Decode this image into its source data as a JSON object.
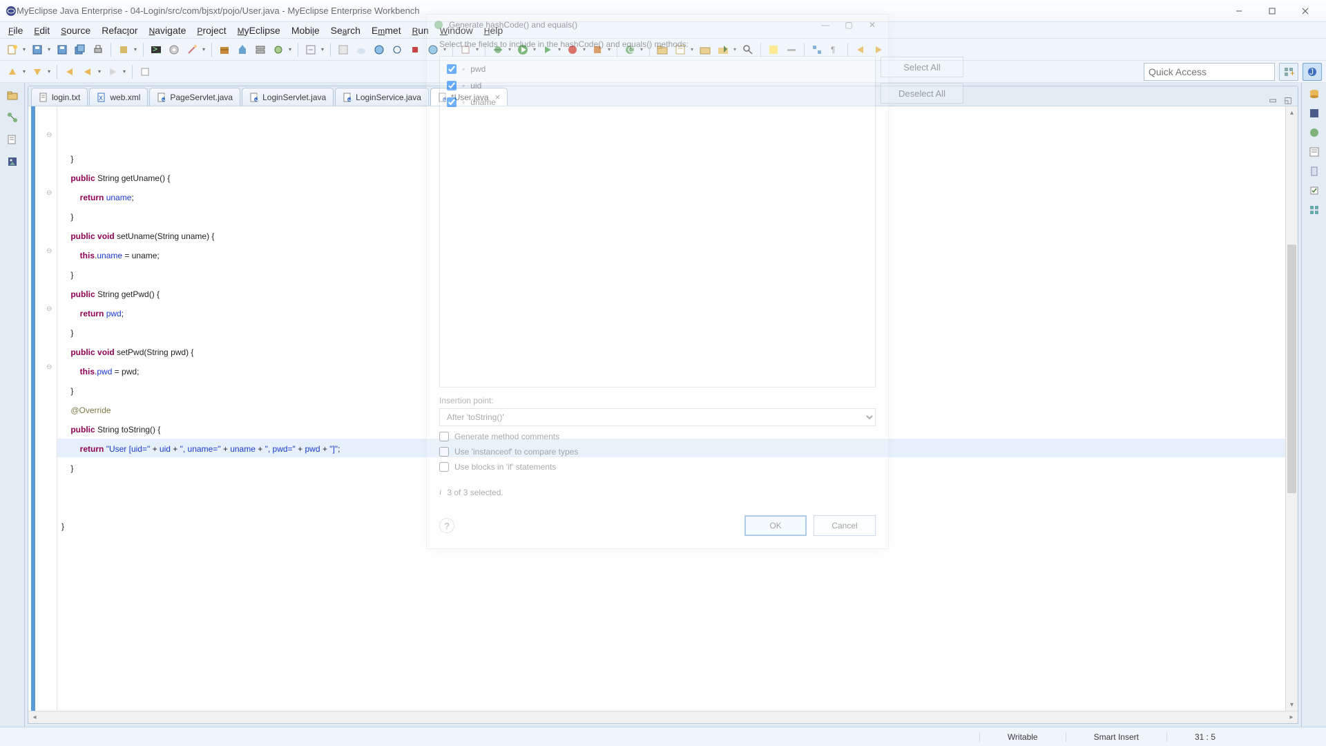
{
  "window": {
    "title": "MyEclipse Java Enterprise - 04-Login/src/com/bjsxt/pojo/User.java - MyEclipse Enterprise Workbench"
  },
  "menu": [
    "File",
    "Edit",
    "Source",
    "Refactor",
    "Navigate",
    "Project",
    "MyEclipse",
    "Mobile",
    "Search",
    "Emmet",
    "Run",
    "Window",
    "Help"
  ],
  "quick_access_placeholder": "Quick Access",
  "tabs": [
    {
      "icon": "text-file-icon",
      "label": "login.txt"
    },
    {
      "icon": "xml-file-icon",
      "label": "web.xml"
    },
    {
      "icon": "java-file-icon",
      "label": "PageServlet.java"
    },
    {
      "icon": "java-file-icon",
      "label": "LoginServlet.java"
    },
    {
      "icon": "java-file-icon",
      "label": "LoginService.java"
    },
    {
      "icon": "java-file-icon",
      "label": "*User.java",
      "active": true
    }
  ],
  "code_lines": [
    "    }",
    "    public String getUname() {",
    "        return uname;",
    "    }",
    "    public void setUname(String uname) {",
    "        this.uname = uname;",
    "    }",
    "    public String getPwd() {",
    "        return pwd;",
    "    }",
    "    public void setPwd(String pwd) {",
    "        this.pwd = pwd;",
    "    }",
    "    @Override",
    "    public String toString() {",
    "        return \"User [uid=\" + uid + \", uname=\" + uname + \", pwd=\" + pwd + \"]\";",
    "    }",
    "    ",
    "",
    "}"
  ],
  "status": {
    "writable": "Writable",
    "insert": "Smart Insert",
    "pos": "31 : 5"
  },
  "dialog": {
    "title": "Generate hashCode() and equals()",
    "instruction": "Select the fields to include in the hashCode() and equals() methods:",
    "fields": [
      "pwd",
      "uid",
      "uname"
    ],
    "select_all": "Select All",
    "deselect_all": "Deselect All",
    "insertion_label": "Insertion point:",
    "insertion_value": "After 'toString()'",
    "opt_comments": "Generate method comments",
    "opt_instanceof": "Use 'instanceof' to compare types",
    "opt_blocks": "Use blocks in 'if' statements",
    "selected_count": "3 of 3 selected.",
    "ok": "OK",
    "cancel": "Cancel"
  }
}
